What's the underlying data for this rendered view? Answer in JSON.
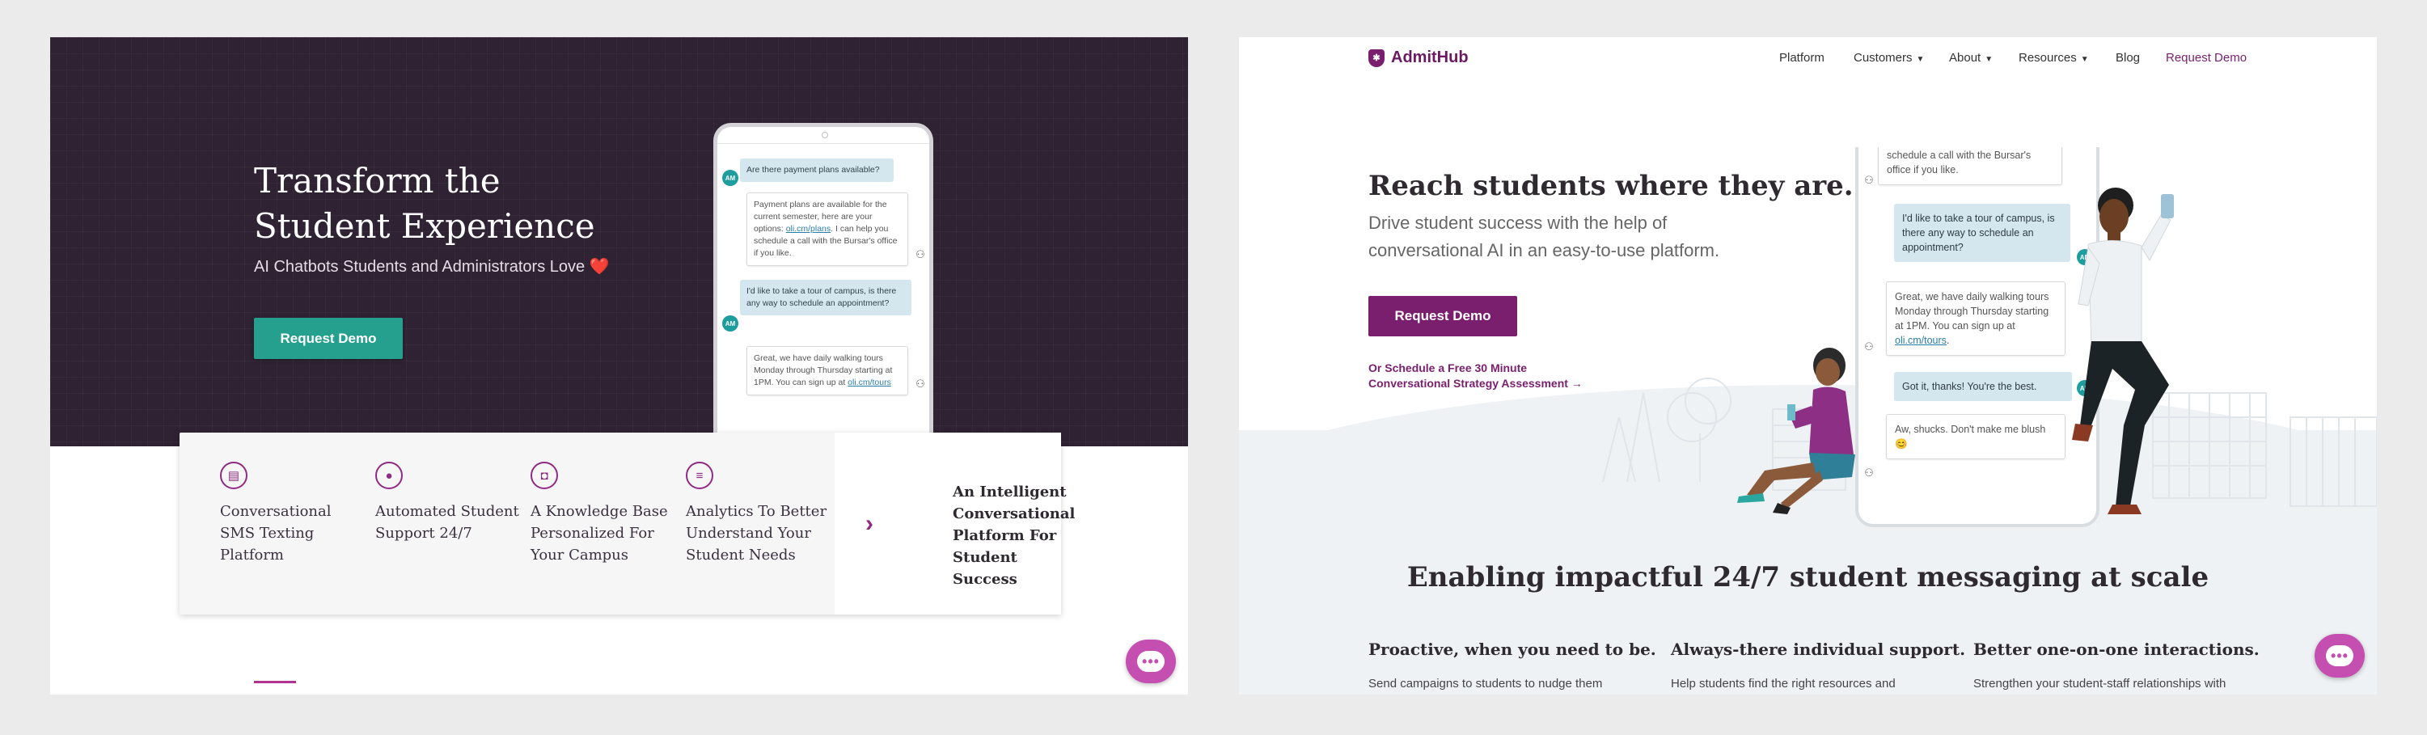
{
  "left": {
    "hero": {
      "title_line1": "Transform the",
      "title_line2": "Student Experience",
      "subtitle": "AI Chatbots Students and Administrators Love",
      "heart": "❤️",
      "cta": "Request Demo"
    },
    "chat": {
      "q1": "Are there payment plans available?",
      "a1_pre": "Payment plans are available for the current semester, here are your options: ",
      "a1_link": "oli.cm/plans",
      "a1_post": ". I can help you schedule a call with the Bursar's office if you like.",
      "q2": "I'd like to take a tour of campus, is there any way to schedule an appointment?",
      "a2_pre": "Great, we have daily walking tours Monday through Thursday starting at 1PM. You can sign up at ",
      "a2_link": "oli.cm/tours",
      "avatar": "AM"
    },
    "features": [
      {
        "label": "Conversational SMS Texting Platform",
        "icon": "chat-icon"
      },
      {
        "label": "Automated Student Support 24/7",
        "icon": "user-icon"
      },
      {
        "label": "A Knowledge Base Personalized For Your Campus",
        "icon": "book-icon"
      },
      {
        "label": "Analytics To Better Understand Your Student Needs",
        "icon": "analytics-icon"
      }
    ],
    "intelligent": "An Intelligent Conversational Platform For Student Success",
    "chevron": "›"
  },
  "right": {
    "logo": "AdmitHub",
    "nav": [
      "Platform",
      "Customers",
      "About",
      "Resources",
      "Blog",
      "Request Demo"
    ],
    "hero": {
      "title": "Reach students where they are.",
      "subtitle": "Drive student success with the help of conversational AI in an easy-to-use platform.",
      "cta": "Request Demo",
      "link_line1": "Or Schedule a Free 30 Minute",
      "link_line2": "Conversational Strategy Assessment →"
    },
    "chat": {
      "a0": "schedule a call with the Bursar's office if you like.",
      "q1": "I'd like to take a tour of campus, is there any way to schedule an appointment?",
      "a1_pre": "Great, we have daily walking tours Monday through Thursday starting at 1PM. You can sign up at ",
      "a1_link": "oli.cm/tours",
      "a1_post": ".",
      "q2": "Got it, thanks! You're the best.",
      "a2": "Aw, shucks. Don't make me blush",
      "a2_emoji": "😊",
      "avatar": "AM"
    },
    "section_title": "Enabling impactful 24/7 student messaging at scale",
    "columns": [
      {
        "title": "Proactive, when you need to be.",
        "text": "Send campaigns to students to nudge them"
      },
      {
        "title": "Always-there individual support.",
        "text": "Help students find the right resources and"
      },
      {
        "title": "Better one-on-one interactions.",
        "text": "Strengthen your student-staff relationships with"
      }
    ]
  },
  "colors": {
    "dark_purple_bg": "#2f2233",
    "teal": "#26a08e",
    "brand_purple": "#7a1f6e",
    "fab_pink": "#c44fb0"
  },
  "fab_glyph": "•••"
}
